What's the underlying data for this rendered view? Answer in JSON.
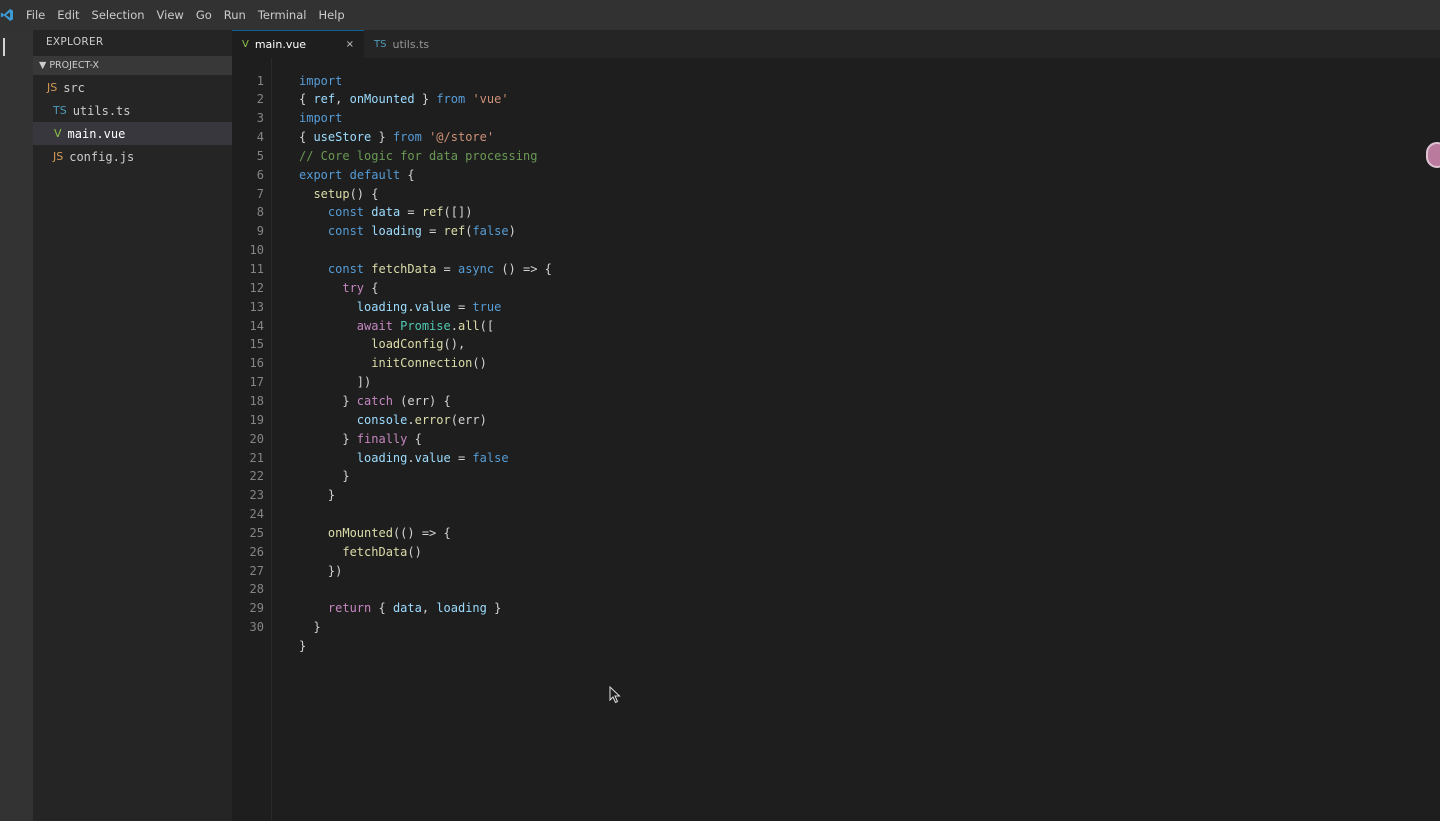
{
  "menubar": {
    "logo_icon": "vscode-logo-icon",
    "items": [
      "File",
      "Edit",
      "Selection",
      "View",
      "Go",
      "Run",
      "Terminal",
      "Help"
    ]
  },
  "sidebar": {
    "title": "EXPLORER",
    "section": {
      "arrow": "▼",
      "label": "PROJECT-X"
    },
    "items": [
      {
        "icon": "JS",
        "label": "src",
        "selected": false
      },
      {
        "icon": "TS",
        "label": "utils.ts",
        "selected": false
      },
      {
        "icon": "V",
        "label": "main.vue",
        "selected": true
      },
      {
        "icon": "JS",
        "label": "config.js",
        "selected": false
      }
    ]
  },
  "tabs": [
    {
      "icon": "V",
      "label": "main.vue",
      "active": true,
      "close": "×"
    },
    {
      "icon": "TS",
      "label": "utils.ts",
      "active": false
    }
  ],
  "editor": {
    "line_numbers": [
      "1",
      "2",
      "3",
      "4",
      "5",
      "6",
      "7",
      "8",
      "9",
      "10",
      "11",
      "12",
      "13",
      "14",
      "15",
      "16",
      "17",
      "18",
      "19",
      "20",
      "21",
      "22",
      "23",
      "24",
      "25",
      "26",
      "27",
      "28",
      "29",
      "30"
    ],
    "code_lines": [
      [
        [
          "kw",
          "import"
        ]
      ],
      [
        [
          "txt",
          "{ "
        ],
        [
          "var",
          "ref"
        ],
        [
          "txt",
          ", "
        ],
        [
          "var",
          "onMounted"
        ],
        [
          "txt",
          " } "
        ],
        [
          "kw",
          "from"
        ],
        [
          "txt",
          " "
        ],
        [
          "str",
          "'vue'"
        ]
      ],
      [
        [
          "kw",
          "import"
        ]
      ],
      [
        [
          "txt",
          "{ "
        ],
        [
          "var",
          "useStore"
        ],
        [
          "txt",
          " } "
        ],
        [
          "kw",
          "from"
        ],
        [
          "txt",
          " "
        ],
        [
          "str",
          "'@/store'"
        ]
      ],
      [
        [
          "com",
          "// Core logic for data processing"
        ]
      ],
      [
        [
          "kw",
          "export"
        ],
        [
          "txt",
          " "
        ],
        [
          "kw",
          "default"
        ],
        [
          "txt",
          " {"
        ]
      ],
      [
        [
          "txt",
          "  "
        ],
        [
          "fn",
          "setup"
        ],
        [
          "txt",
          "() {"
        ]
      ],
      [
        [
          "txt",
          "    "
        ],
        [
          "kw",
          "const"
        ],
        [
          "txt",
          " "
        ],
        [
          "var",
          "data"
        ],
        [
          "txt",
          " = "
        ],
        [
          "fn",
          "ref"
        ],
        [
          "txt",
          "([])"
        ]
      ],
      [
        [
          "txt",
          "    "
        ],
        [
          "kw",
          "const"
        ],
        [
          "txt",
          " "
        ],
        [
          "var",
          "loading"
        ],
        [
          "txt",
          " = "
        ],
        [
          "fn",
          "ref"
        ],
        [
          "txt",
          "("
        ],
        [
          "kw",
          "false"
        ],
        [
          "txt",
          ")"
        ]
      ],
      [
        [
          "txt",
          ""
        ]
      ],
      [
        [
          "txt",
          "    "
        ],
        [
          "kw",
          "const"
        ],
        [
          "txt",
          " "
        ],
        [
          "fn",
          "fetchData"
        ],
        [
          "txt",
          " = "
        ],
        [
          "kw",
          "async"
        ],
        [
          "txt",
          " () => {"
        ]
      ],
      [
        [
          "txt",
          "      "
        ],
        [
          "ctl",
          "try"
        ],
        [
          "txt",
          " {"
        ]
      ],
      [
        [
          "txt",
          "        "
        ],
        [
          "var",
          "loading"
        ],
        [
          "txt",
          "."
        ],
        [
          "var",
          "value"
        ],
        [
          "txt",
          " = "
        ],
        [
          "kw",
          "true"
        ]
      ],
      [
        [
          "txt",
          "        "
        ],
        [
          "ctl",
          "await"
        ],
        [
          "txt",
          " "
        ],
        [
          "cls",
          "Promise"
        ],
        [
          "txt",
          "."
        ],
        [
          "fn",
          "all"
        ],
        [
          "txt",
          "(["
        ]
      ],
      [
        [
          "txt",
          "          "
        ],
        [
          "fn",
          "loadConfig"
        ],
        [
          "txt",
          "(),"
        ]
      ],
      [
        [
          "txt",
          "          "
        ],
        [
          "fn",
          "initConnection"
        ],
        [
          "txt",
          "()"
        ]
      ],
      [
        [
          "txt",
          "        ])"
        ]
      ],
      [
        [
          "txt",
          "      } "
        ],
        [
          "ctl",
          "catch"
        ],
        [
          "txt",
          " (err) {"
        ]
      ],
      [
        [
          "txt",
          "        "
        ],
        [
          "var",
          "console"
        ],
        [
          "txt",
          "."
        ],
        [
          "fn",
          "error"
        ],
        [
          "txt",
          "(err)"
        ]
      ],
      [
        [
          "txt",
          "      } "
        ],
        [
          "ctl",
          "finally"
        ],
        [
          "txt",
          " {"
        ]
      ],
      [
        [
          "txt",
          "        "
        ],
        [
          "var",
          "loading"
        ],
        [
          "txt",
          "."
        ],
        [
          "var",
          "value"
        ],
        [
          "txt",
          " = "
        ],
        [
          "kw",
          "false"
        ]
      ],
      [
        [
          "txt",
          "      }"
        ]
      ],
      [
        [
          "txt",
          "    }"
        ]
      ],
      [
        [
          "txt",
          ""
        ]
      ],
      [
        [
          "txt",
          "    "
        ],
        [
          "fn",
          "onMounted"
        ],
        [
          "txt",
          "(() => {"
        ]
      ],
      [
        [
          "txt",
          "      "
        ],
        [
          "fn",
          "fetchData"
        ],
        [
          "txt",
          "()"
        ]
      ],
      [
        [
          "txt",
          "    })"
        ]
      ],
      [
        [
          "txt",
          ""
        ]
      ],
      [
        [
          "txt",
          "    "
        ],
        [
          "ctl",
          "return"
        ],
        [
          "txt",
          " { "
        ],
        [
          "var",
          "data"
        ],
        [
          "txt",
          ", "
        ],
        [
          "var",
          "loading"
        ],
        [
          "txt",
          " }"
        ]
      ],
      [
        [
          "txt",
          "  }"
        ]
      ],
      [
        [
          "txt",
          "}"
        ]
      ]
    ]
  },
  "colors": {
    "keyword": "#569cd6",
    "control": "#c586c0",
    "string": "#ce9178",
    "comment": "#6a9955",
    "variable": "#9cdcfe",
    "function": "#dcdcaa",
    "class": "#4ec9b0"
  }
}
